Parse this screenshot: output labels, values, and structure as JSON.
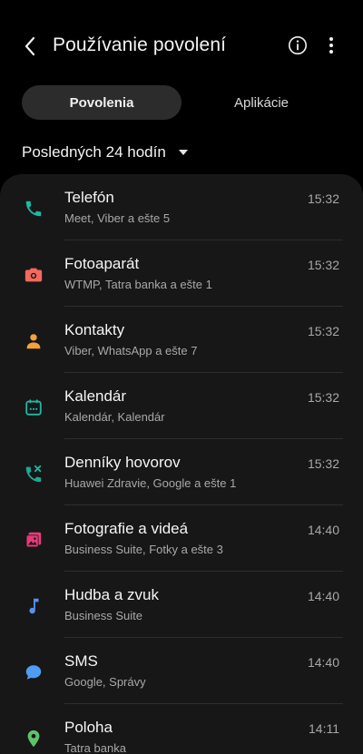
{
  "header": {
    "title": "Používanie povolení",
    "back_icon": "back-arrow-icon",
    "info_icon": "info-icon",
    "more_icon": "more-vertical-icon"
  },
  "tabs": [
    {
      "label": "Povolenia",
      "active": true
    },
    {
      "label": "Aplikácie",
      "active": false
    }
  ],
  "filter": {
    "period_label": "Posledných 24 hodín"
  },
  "permissions": [
    {
      "title": "Telefón",
      "subtitle": "Meet, Viber a ešte 5",
      "time": "15:32",
      "icon": "phone-icon",
      "color": "#1fb8a2"
    },
    {
      "title": "Fotoaparát",
      "subtitle": "WTMP, Tatra banka a ešte 1",
      "time": "15:32",
      "icon": "camera-icon",
      "color": "#f2695f"
    },
    {
      "title": "Kontakty",
      "subtitle": "Viber, WhatsApp a ešte 7",
      "time": "15:32",
      "icon": "contact-person-icon",
      "color": "#f7a13a"
    },
    {
      "title": "Kalendár",
      "subtitle": "Kalendár, Kalendár",
      "time": "15:32",
      "icon": "calendar-icon",
      "color": "#1fb8a2"
    },
    {
      "title": "Denníky hovorov",
      "subtitle": "Huawei Zdravie, Google a ešte 1",
      "time": "15:32",
      "icon": "call-log-icon",
      "color": "#1fb8a2"
    },
    {
      "title": "Fotografie a videá",
      "subtitle": "Business Suite, Fotky a ešte 3",
      "time": "14:40",
      "icon": "photos-videos-icon",
      "color": "#e8397a"
    },
    {
      "title": "Hudba a zvuk",
      "subtitle": "Business Suite",
      "time": "14:40",
      "icon": "music-note-icon",
      "color": "#5b8ff0"
    },
    {
      "title": "SMS",
      "subtitle": "Google, Správy",
      "time": "14:40",
      "icon": "sms-bubble-icon",
      "color": "#4f9cf2"
    },
    {
      "title": "Poloha",
      "subtitle": "Tatra banka",
      "time": "14:11",
      "icon": "location-pin-icon",
      "color": "#5fc26a"
    }
  ]
}
